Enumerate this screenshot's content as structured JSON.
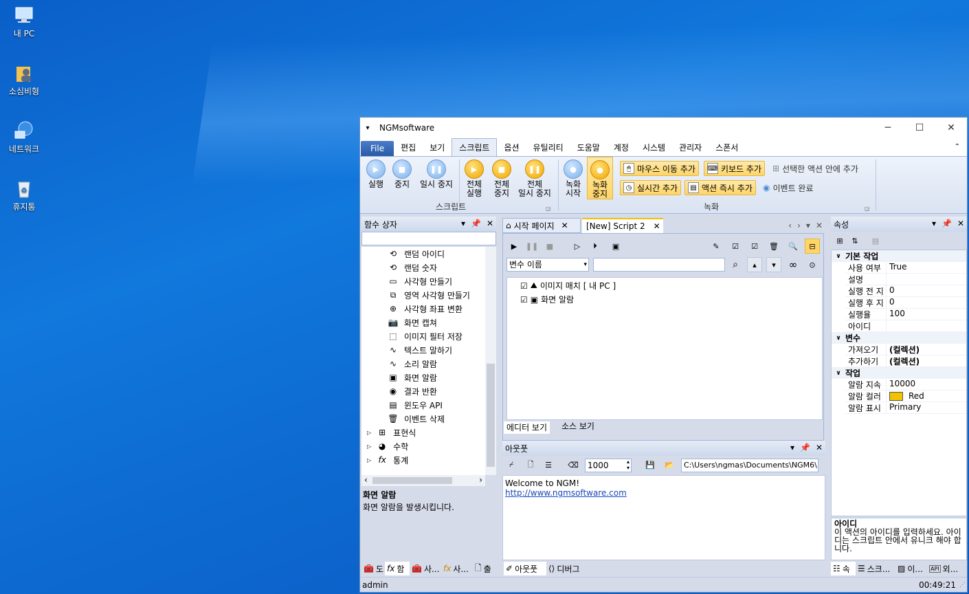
{
  "desktop": {
    "icons": [
      {
        "label": "내 PC",
        "icon": "computer-icon"
      },
      {
        "label": "소심비형",
        "icon": "user-folder-icon"
      },
      {
        "label": "네트워크",
        "icon": "network-icon"
      },
      {
        "label": "휴지통",
        "icon": "recycle-bin-icon"
      }
    ]
  },
  "window": {
    "title": "NGMsoftware",
    "controls": {
      "minimize": "─",
      "maximize": "☐",
      "close": "✕"
    }
  },
  "ribbon_tabs": [
    "File",
    "편집",
    "보기",
    "스크립트",
    "옵션",
    "유틸리티",
    "도움말",
    "계정",
    "시스템",
    "관리자",
    "스폰서"
  ],
  "ribbon_active": "스크립트",
  "ribbon": {
    "script": {
      "run": "실행",
      "stop": "중지",
      "pause": "일시 중지",
      "run_all_1": "전체",
      "run_all_2": "실행",
      "stop_all_1": "전체",
      "stop_all_2": "중지",
      "pause_all_1": "전체",
      "pause_all_2": "일시 중지",
      "group": "스크립트"
    },
    "record": {
      "start_1": "녹화",
      "start_2": "시작",
      "stop_1": "녹화",
      "stop_2": "중지",
      "mouse": "마우스 이동 추가",
      "keyboard": "키보드 추가",
      "in_action": "선택한 액션 안에 추가",
      "realtime": "실시간 추가",
      "immediate": "액션 즉시 추가",
      "event_done": "이벤트 완료",
      "group": "녹화"
    }
  },
  "toolbox": {
    "title": "함수 상자",
    "items": [
      "랜덤 아이디",
      "랜덤 숫자",
      "사각형 만들기",
      "영역 사각형 만들기",
      "사각형 좌표 변환",
      "화면 캡쳐",
      "이미지 필터 저장",
      "텍스트 말하기",
      "소리 알람",
      "화면 알람",
      "결과 반환",
      "윈도우 API",
      "이벤트 삭제"
    ],
    "groups": [
      "표현식",
      "수학",
      "통계"
    ],
    "desc_title": "화면 알람",
    "desc_text": "화면 알람을 발생시킵니다.",
    "bottom_tabs": [
      "도",
      "함",
      "사...",
      "사...",
      "출"
    ]
  },
  "editor": {
    "tabs": [
      "시작 페이지",
      "[New] Script 2"
    ],
    "var_select": "변수 이름",
    "tree": [
      "이미지 매치 [ 내 PC ]",
      "화면 알람"
    ],
    "view_tabs": [
      "에디터 보기",
      "소스 보기"
    ]
  },
  "output": {
    "title": "아웃풋",
    "count": "1000",
    "path": "C:\\Users\\ngmas\\Documents\\NGM6\\",
    "lines": [
      "Welcome to NGM!"
    ],
    "link": "http://www.ngmsoftware.com",
    "bottom_tabs": [
      "아웃풋",
      "디버그"
    ]
  },
  "properties": {
    "title": "속성",
    "cats": [
      {
        "name": "기본 작업",
        "rows": [
          [
            "사용 여부",
            "True"
          ],
          [
            "설명",
            ""
          ],
          [
            "실행 전 지",
            "0"
          ],
          [
            "실행 후 지",
            "0"
          ],
          [
            "실행율",
            "100"
          ],
          [
            "아이디",
            ""
          ]
        ]
      },
      {
        "name": "변수",
        "rows": [
          [
            "가져오기",
            "(컬렉션)"
          ],
          [
            "추가하기",
            "(컬렉션)"
          ]
        ]
      },
      {
        "name": "작업",
        "rows": [
          [
            "알람 지속",
            "10000"
          ],
          [
            "알람 컬러",
            "Red"
          ],
          [
            "알람 표시",
            "Primary"
          ]
        ]
      }
    ],
    "desc_title": "아이디",
    "desc_text": "이 액션의 아이디를 입력하세요. 아이디는 스크립트 안에서 유니크 해야 합니다.",
    "bottom_tabs": [
      "속",
      "스크...",
      "이...",
      "외..."
    ],
    "alarm_color": "#f2c100"
  },
  "status": {
    "user": "admin",
    "time": "00:49:21"
  }
}
